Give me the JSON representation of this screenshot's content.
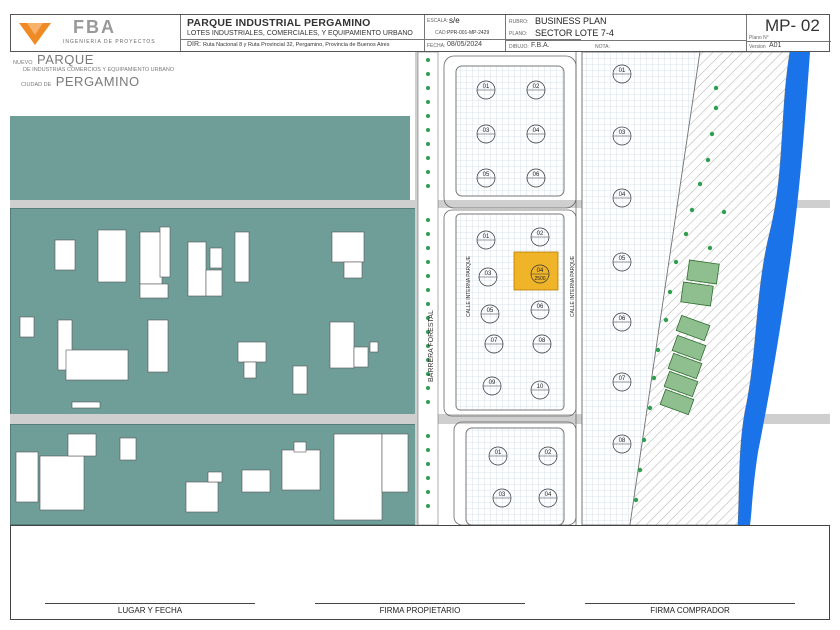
{
  "title_block": {
    "company": "FBA",
    "company_sub": "INGENIERIA DE PROYECTOS",
    "project_title": "PARQUE INDUSTRIAL PERGAMINO",
    "project_subtitle": "LOTES INDUSTRIALES, COMERCIALES, Y EQUIPAMIENTO URBANO",
    "dir_label": "DIR:",
    "address": "Ruta Nacional 8 y Ruta Provincial 32, Pergamino, Provincia de Buenos Aires",
    "escala_label": "ESCALA:",
    "escala_value": "s/e",
    "cad_label": "CAD:",
    "cad_value": "PPR-001-MP-2429",
    "fecha_label": "FECHA:",
    "fecha_value": "08/05/2024",
    "rubro_label": "RUBRO:",
    "rubro_value": "BUSINESS PLAN",
    "plano_label": "PLANO:",
    "plano_value": "SECTOR LOTE 7-4",
    "dibujo_label": "DIBUJO:",
    "dibujo_value": "F.B.A.",
    "nota_label": "NOTA:",
    "sheet_code": "MP- 02",
    "plano_n_label": "Plano N°",
    "version_label": "Version",
    "version_value": "A01"
  },
  "map_notes": {
    "line1_small": "NUEVO",
    "line1_big": "PARQUE",
    "line2": "DE INDUSTRIAS COMERCIOS Y EQUIPAMIENTO URBANO",
    "line3_small": "CIUDAD DE",
    "line3_big": "PERGAMINO"
  },
  "roads": {
    "forestal": "BARRERA FORESTAL",
    "interna_1": "CALLE INTERNA PARQUE",
    "interna_2": "CALLE INTERNA PARQUE"
  },
  "lots": [
    {
      "id": "01",
      "area": ""
    },
    {
      "id": "02",
      "area": ""
    },
    {
      "id": "03",
      "area": ""
    },
    {
      "id": "04",
      "area": ""
    },
    {
      "id": "05",
      "area": ""
    },
    {
      "id": "06",
      "area": ""
    },
    {
      "id": "01",
      "area": ""
    },
    {
      "id": "02",
      "area": ""
    },
    {
      "id": "03",
      "area": ""
    },
    {
      "id": "04",
      "area": "2500"
    },
    {
      "id": "05",
      "area": ""
    },
    {
      "id": "06",
      "area": ""
    },
    {
      "id": "07",
      "area": ""
    },
    {
      "id": "08",
      "area": ""
    },
    {
      "id": "09",
      "area": ""
    },
    {
      "id": "10",
      "area": ""
    },
    {
      "id": "01",
      "area": ""
    },
    {
      "id": "02",
      "area": ""
    },
    {
      "id": "03",
      "area": ""
    },
    {
      "id": "04",
      "area": ""
    },
    {
      "id": "01",
      "area": ""
    },
    {
      "id": "03",
      "area": ""
    },
    {
      "id": "04",
      "area": ""
    },
    {
      "id": "05",
      "area": ""
    },
    {
      "id": "06",
      "area": ""
    },
    {
      "id": "07",
      "area": ""
    },
    {
      "id": "08",
      "area": ""
    }
  ],
  "colors": {
    "teal": "#6f9d98",
    "highlight": "#f0b429",
    "river": "#1a73e8",
    "tree": "#2e9e4f",
    "sport": "#8fbf8f"
  },
  "signatures": {
    "lugar_fecha": "LUGAR Y FECHA",
    "firma_propietario": "FIRMA PROPIETARIO",
    "firma_comprador": "FIRMA COMPRADOR"
  }
}
